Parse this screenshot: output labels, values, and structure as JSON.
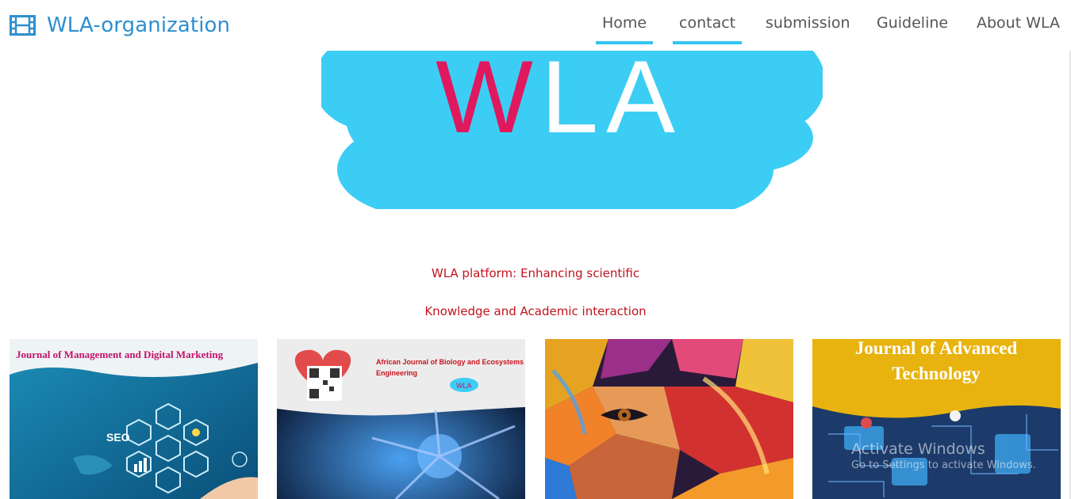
{
  "brand": {
    "name": "WLA-organization",
    "icon": "film-icon"
  },
  "nav": [
    {
      "label": "Home",
      "active": true
    },
    {
      "label": "contact",
      "active": true
    },
    {
      "label": "submission",
      "active": false
    },
    {
      "label": "Guideline",
      "active": false
    },
    {
      "label": "About WLA",
      "active": false
    }
  ],
  "hero": {
    "logo_text": "WLA"
  },
  "tagline": {
    "line1": "WLA platform: Enhancing scientific",
    "line2": "Knowledge and Academic interaction"
  },
  "cards": [
    {
      "title": "Journal of Management and Digital Marketing",
      "badge": "SEO"
    },
    {
      "title_line1": "African Journal of Biology and Ecosystems",
      "title_line2": "Engineering",
      "badge": "WLA"
    },
    {
      "title": ""
    },
    {
      "title_line1": "Journal of Advanced",
      "title_line2": "Technology"
    }
  ],
  "watermark": {
    "line1": "Activate Windows",
    "line2": "Go to Settings to activate Windows."
  },
  "colors": {
    "accent": "#33c4f2",
    "brand": "#2f8fcf",
    "tagline": "#c0141c"
  }
}
